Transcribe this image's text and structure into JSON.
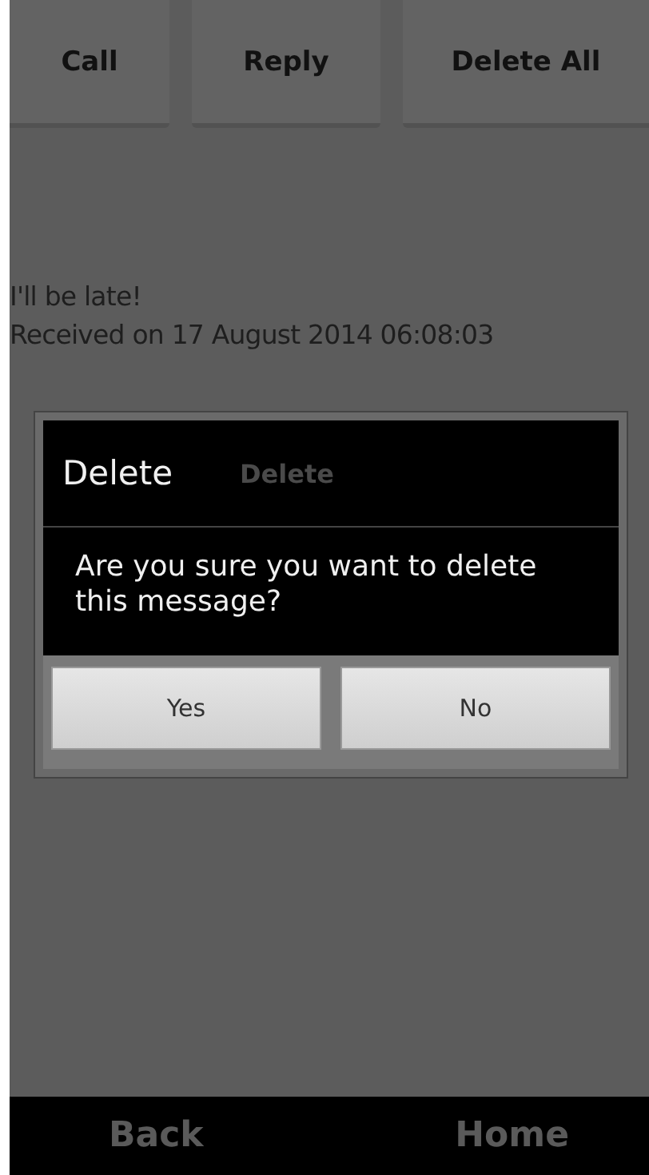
{
  "top_buttons": [
    "Call",
    "Reply",
    "Delete All"
  ],
  "message": {
    "text": "I'll be late!",
    "received": "Received on 17 August 2014 06:08:03"
  },
  "background_button": {
    "label": "Delete"
  },
  "dialog": {
    "title": "Delete",
    "body": "Are you sure you want to delete this message?",
    "buttons": [
      "Yes",
      "No"
    ]
  },
  "bottom_bar": [
    "Back",
    "Home"
  ]
}
